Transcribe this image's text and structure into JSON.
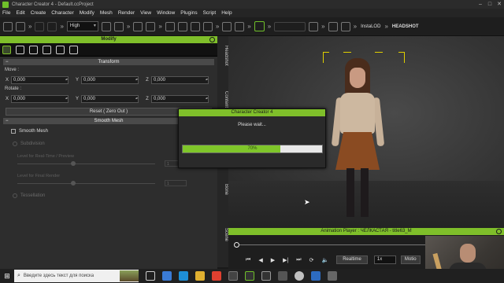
{
  "window": {
    "title": "Character Creator 4 - Default.ccProject"
  },
  "menu": [
    "File",
    "Edit",
    "Create",
    "Character",
    "Modify",
    "Mesh",
    "Render",
    "View",
    "Window",
    "Plugins",
    "Script",
    "Help"
  ],
  "toolbar": {
    "quality": "High",
    "instalod": "InstaLOD",
    "headshot": "HEADSHOT"
  },
  "modify_panel": {
    "header": "Modify",
    "transform": {
      "header": "Transform",
      "move_label": "Move :",
      "rotate_label": "Rotate :",
      "move": {
        "x": "0,000",
        "y": "0,000",
        "z": "0,000"
      },
      "rotate": {
        "x": "0,000",
        "y": "0,000",
        "z": "0,000"
      },
      "axis_x": "X",
      "axis_y": "Y",
      "axis_z": "Z",
      "reset": "Reset ( Zero Out )"
    },
    "smooth_mesh": {
      "header": "Smooth Mesh",
      "checkbox": "Smooth Mesh",
      "subdivision": "Subdivision",
      "level_realtime": "Level for Real-Time / Preview",
      "level_render": "Level for Final Render",
      "tessellation": "Tessellation",
      "realtime_level": "1",
      "render_level": "1"
    }
  },
  "side_tabs": [
    "Headshot",
    "Content",
    "Bone",
    "Scene"
  ],
  "dialog": {
    "title": "Character Creator 4",
    "message": "Please wait...",
    "progress": 0.7,
    "progress_text": "70%"
  },
  "animation_player": {
    "title": "Animation Player : ЧЕЛКАСТАЯ - title63_M",
    "realtime": "Realtime",
    "speed": "1x",
    "motion": "Motio"
  },
  "taskbar": {
    "search_placeholder": "Введите здесь текст для поиска"
  },
  "colors": {
    "accent": "#7fbf2a",
    "panel": "#2d2d2d",
    "selection_bracket": "#e0d000"
  }
}
